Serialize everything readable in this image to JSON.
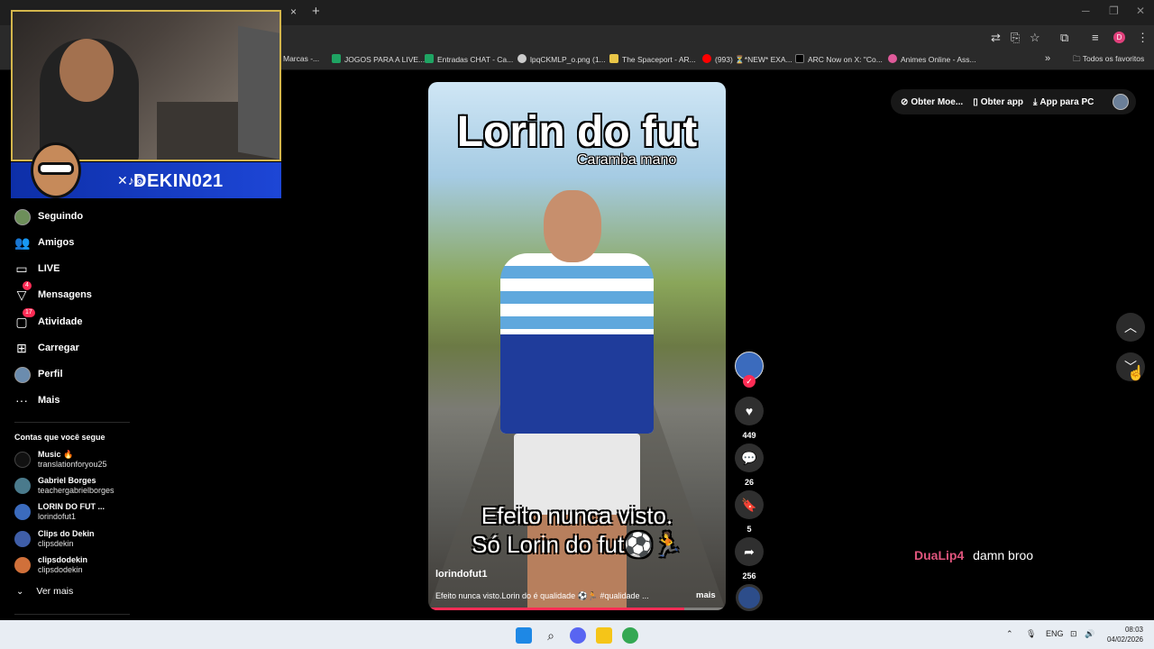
{
  "browser": {
    "tab_close": "×",
    "tab_new": "+",
    "bookmarks": [
      {
        "label": "Marcas -...",
        "color": "#888888"
      },
      {
        "label": "JOGOS PARA A LIVE...",
        "color": "#1fa463"
      },
      {
        "label": "Entradas CHAT - Ca...",
        "color": "#1fa463"
      },
      {
        "label": "lpqCKMLP_o.png (1...",
        "color": "#cccccc"
      },
      {
        "label": "The Spaceport - AR...",
        "color": "#e8c547"
      },
      {
        "label": "(993) ⏳*NEW* EXA...",
        "color": "#ff0000"
      },
      {
        "label": "ARC Now on X: \"Co...",
        "color": "#000000"
      },
      {
        "label": "Animes Online - Ass...",
        "color": "#e05a9a"
      }
    ],
    "bookmarks_more": "»",
    "all_favorites": "Todos os favoritos",
    "profile_initial": "D"
  },
  "stream": {
    "handle": "DEKIN021"
  },
  "sidebar": {
    "items": [
      {
        "label": "Seguindo",
        "icon": "avatar"
      },
      {
        "label": "Amigos",
        "icon": "friends-icon"
      },
      {
        "label": "LIVE",
        "icon": "live-icon"
      },
      {
        "label": "Mensagens",
        "icon": "messages-icon",
        "badge": "4"
      },
      {
        "label": "Atividade",
        "icon": "activity-icon",
        "badge": "17"
      },
      {
        "label": "Carregar",
        "icon": "upload-icon"
      },
      {
        "label": "Perfil",
        "icon": "avatar"
      },
      {
        "label": "Mais",
        "icon": "more-icon"
      }
    ],
    "following_title": "Contas que você segue",
    "following": [
      {
        "name": "Music 🔥",
        "sub": "translationforyou25",
        "color": "#111111"
      },
      {
        "name": "Gabriel Borges",
        "sub": "teachergabrielborges",
        "color": "#4a7a8c"
      },
      {
        "name": "LORIN DO FUT ...",
        "sub": "lorindofut1",
        "color": "#3b6bbd"
      },
      {
        "name": "Clips do Dekin",
        "sub": "clipsdekin",
        "color": "#3f5ea8"
      },
      {
        "name": "clipsdodekin",
        "sub": "clipsdodekin",
        "color": "#d0703a"
      }
    ],
    "see_more": "Ver mais"
  },
  "video": {
    "overlay_title": "Lorin do fut",
    "overlay_sub": "Caramba mano",
    "caption_1": "Efeito nunca visto.",
    "caption_2": "Só Lorin do fut⚽🏃",
    "author": "lorindofut1",
    "description": "Efeito nunca visto.Lorin do é qualidade ⚽🏃 #qualidade ...",
    "more": "mais",
    "progress": 0.86
  },
  "actions": {
    "likes": "449",
    "comments": "26",
    "saves": "5",
    "shares": "256"
  },
  "topbar": {
    "coins": "Obter Moe...",
    "get_app": "Obter app",
    "pc_app": "App para PC"
  },
  "chat": {
    "user": "DuaLip4",
    "message": "damn broo"
  },
  "taskbar": {
    "lang": "ENG",
    "time": "08:03",
    "date": "04/02/2026"
  }
}
